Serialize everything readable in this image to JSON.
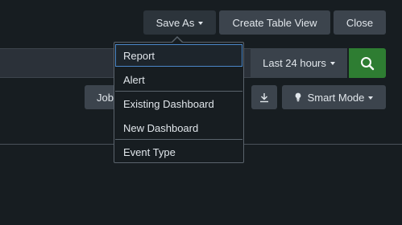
{
  "toolbar": {
    "save_as_label": "Save As",
    "create_table_view_label": "Create Table View",
    "close_label": "Close"
  },
  "search": {
    "time_range": "Last 24 hours",
    "search_button_icon": "search-icon"
  },
  "actions": {
    "job_label": "Job",
    "export_icon": "download-icon",
    "smart_mode_label": "Smart Mode",
    "smart_mode_icon": "lightbulb-icon"
  },
  "save_as_menu": {
    "items": [
      {
        "label": "Report"
      },
      {
        "label": "Alert"
      },
      {
        "label": "Existing Dashboard"
      },
      {
        "label": "New Dashboard"
      },
      {
        "label": "Event Type"
      }
    ]
  },
  "colors": {
    "background": "#171d21",
    "button": "#3c444d",
    "search_button": "#2e7d32",
    "menu_highlight_border": "#4b87c9"
  }
}
